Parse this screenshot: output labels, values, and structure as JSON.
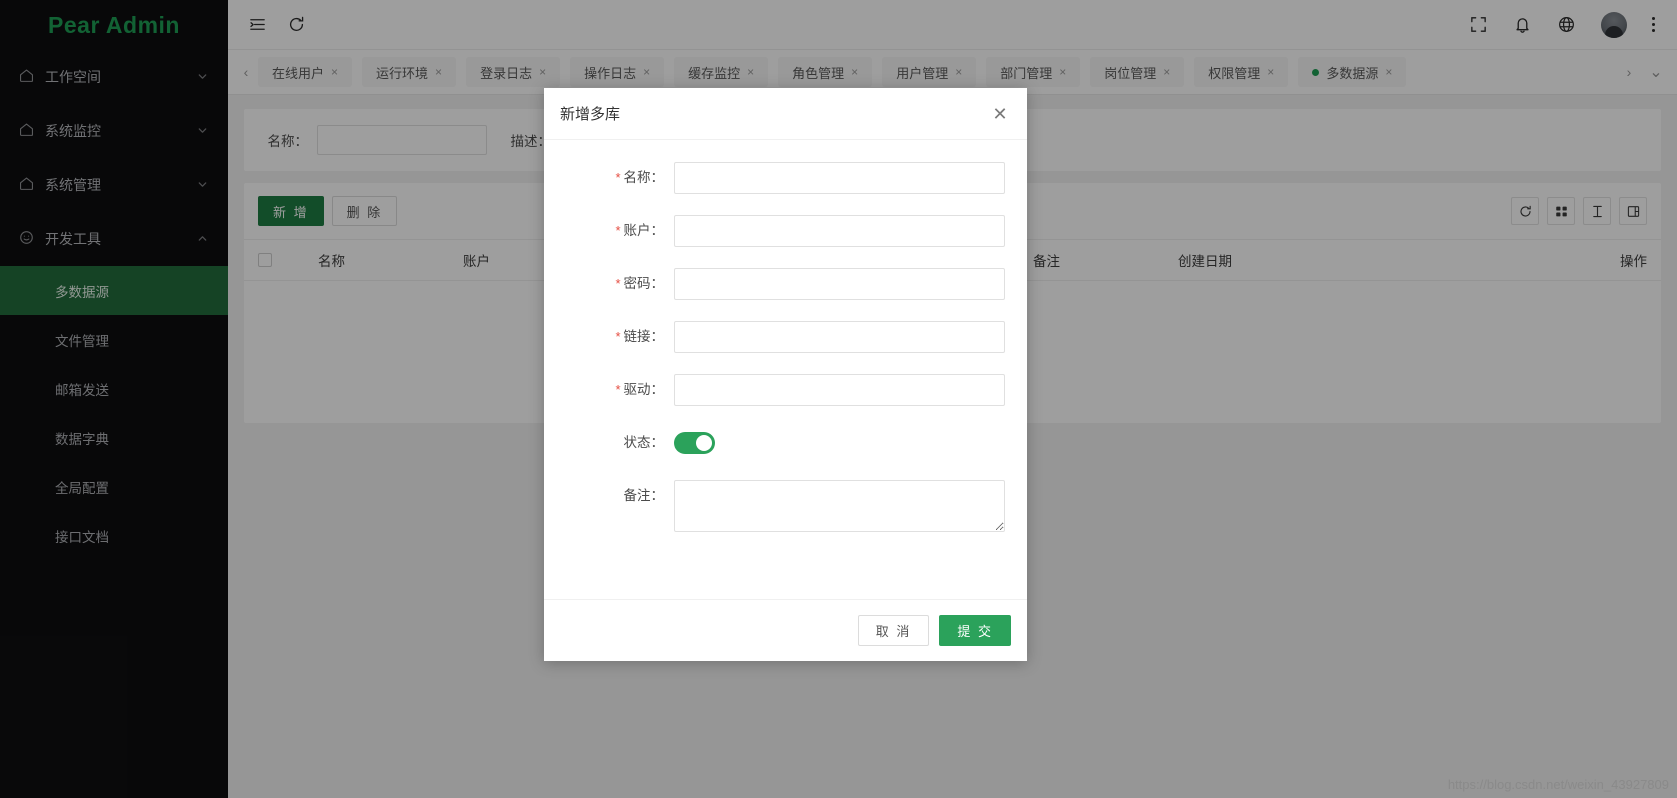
{
  "brand": {
    "title": "Pear Admin"
  },
  "sidebar": {
    "groups": [
      {
        "label": "工作空间",
        "icon": "home-icon",
        "chevron": "chevron-down-icon",
        "expanded": false
      },
      {
        "label": "系统监控",
        "icon": "home-icon",
        "chevron": "chevron-down-icon",
        "expanded": false
      },
      {
        "label": "系统管理",
        "icon": "home-icon",
        "chevron": "chevron-down-icon",
        "expanded": false
      },
      {
        "label": "开发工具",
        "icon": "clock-icon",
        "chevron": "chevron-up-icon",
        "expanded": true
      }
    ],
    "sub_items": [
      {
        "label": "多数据源",
        "active": true
      },
      {
        "label": "文件管理",
        "active": false
      },
      {
        "label": "邮箱发送",
        "active": false
      },
      {
        "label": "数据字典",
        "active": false
      },
      {
        "label": "全局配置",
        "active": false
      },
      {
        "label": "接口文档",
        "active": false
      }
    ],
    "active_color": "#236C3C",
    "background": "#0e0e10"
  },
  "topbar": {
    "left_icons": [
      {
        "name": "menu-collapse-icon"
      },
      {
        "name": "refresh-icon"
      }
    ],
    "right_icons": [
      {
        "name": "fullscreen-icon"
      },
      {
        "name": "bell-icon"
      },
      {
        "name": "globe-icon"
      },
      {
        "name": "avatar"
      },
      {
        "name": "more-vertical-icon"
      }
    ]
  },
  "tabs": {
    "prev_label": "‹",
    "next_label": "›",
    "more_label": "⌄",
    "items": [
      {
        "label": "在线用户",
        "active": false,
        "close": "×"
      },
      {
        "label": "运行环境",
        "active": false,
        "close": "×"
      },
      {
        "label": "登录日志",
        "active": false,
        "close": "×"
      },
      {
        "label": "操作日志",
        "active": false,
        "close": "×"
      },
      {
        "label": "缓存监控",
        "active": false,
        "close": "×"
      },
      {
        "label": "角色管理",
        "active": false,
        "close": "×"
      },
      {
        "label": "用户管理",
        "active": false,
        "close": "×"
      },
      {
        "label": "部门管理",
        "active": false,
        "close": "×"
      },
      {
        "label": "岗位管理",
        "active": false,
        "close": "×"
      },
      {
        "label": "权限管理",
        "active": false,
        "close": "×"
      },
      {
        "label": "多数据源",
        "active": true,
        "close": "×"
      }
    ]
  },
  "search": {
    "name_label": "名称：",
    "name_value": "",
    "name_placeholder": "",
    "desc_label": "描述：",
    "desc_value": "",
    "desc_placeholder": ""
  },
  "table": {
    "add_label": "新 增",
    "delete_label": "删 除",
    "tool_icons": [
      {
        "name": "refresh-icon"
      },
      {
        "name": "column-filter-icon"
      },
      {
        "name": "export-icon"
      },
      {
        "name": "print-icon"
      }
    ],
    "columns": [
      {
        "label": "",
        "type": "checkbox"
      },
      {
        "label": "名称"
      },
      {
        "label": "账户"
      },
      {
        "label": "备注"
      },
      {
        "label": "创建日期"
      },
      {
        "label": "操作"
      }
    ],
    "rows": []
  },
  "modal": {
    "title": "新增多库",
    "close_label": "✕",
    "fields": [
      {
        "label": "名称：",
        "required": true,
        "type": "text",
        "value": "",
        "placeholder": ""
      },
      {
        "label": "账户：",
        "required": true,
        "type": "text",
        "value": "",
        "placeholder": ""
      },
      {
        "label": "密码：",
        "required": true,
        "type": "text",
        "value": "",
        "placeholder": ""
      },
      {
        "label": "链接：",
        "required": true,
        "type": "text",
        "value": "",
        "placeholder": ""
      },
      {
        "label": "驱动：",
        "required": true,
        "type": "text",
        "value": "",
        "placeholder": ""
      },
      {
        "label": "状态：",
        "required": false,
        "type": "switch",
        "value": "on"
      },
      {
        "label": "备注：",
        "required": false,
        "type": "textarea",
        "value": "",
        "placeholder": ""
      }
    ],
    "cancel_label": "取 消",
    "submit_label": "提 交",
    "submit_color": "#2BA25B"
  },
  "watermark": {
    "text": "https://blog.csdn.net/weixin_43927809"
  }
}
